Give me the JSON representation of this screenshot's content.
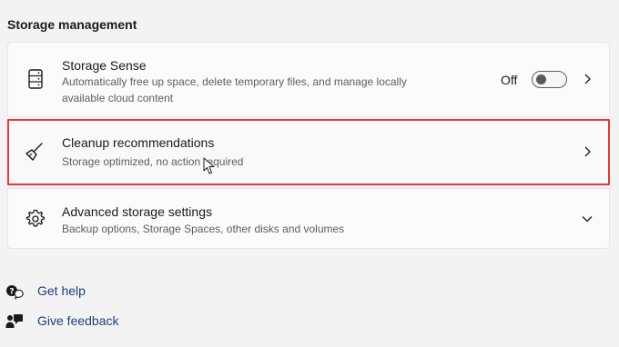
{
  "section": {
    "title": "Storage management"
  },
  "items": [
    {
      "title": "Storage Sense",
      "description": "Automatically free up space, delete temporary files, and manage locally available cloud content",
      "toggle_label": "Off",
      "toggle_state": "off",
      "icon": "hard-drive-icon"
    },
    {
      "title": "Cleanup recommendations",
      "description": "Storage optimized, no action required",
      "icon": "broom-icon",
      "highlight_color": "#e0393e"
    },
    {
      "title": "Advanced storage settings",
      "description": "Backup options, Storage Spaces, other disks and volumes",
      "icon": "gear-icon"
    }
  ],
  "links": {
    "help": "Get help",
    "feedback": "Give feedback"
  },
  "colors": {
    "link": "#1f3f7a",
    "highlight": "#e0393e"
  }
}
